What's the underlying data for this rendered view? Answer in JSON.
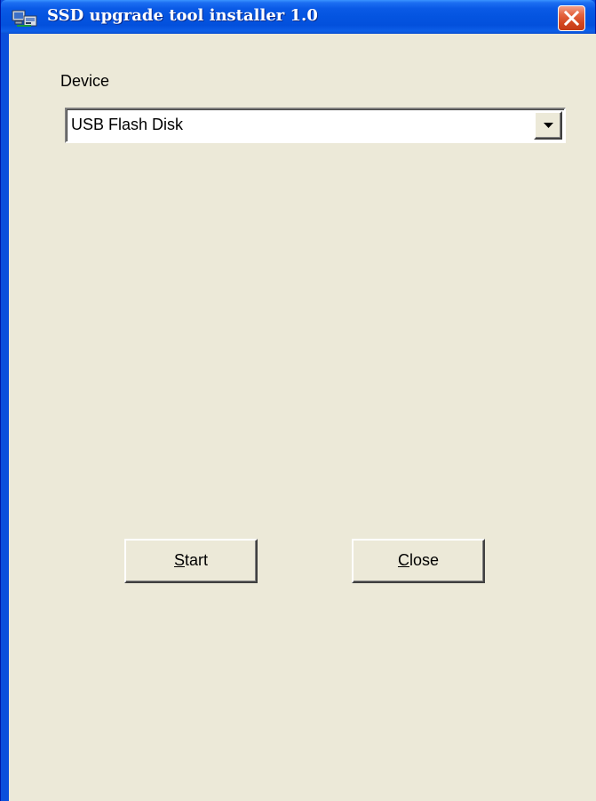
{
  "window": {
    "title": "SSD upgrade tool installer 1.0",
    "app_icon": "installer-computer-icon",
    "close_icon": "close-icon"
  },
  "form": {
    "device_label": "Device",
    "device_select": {
      "selected": "USB Flash Disk",
      "arrow_icon": "dropdown-arrow-icon"
    }
  },
  "buttons": {
    "start": {
      "first": "S",
      "rest": "tart"
    },
    "close": {
      "first": "C",
      "rest": "lose"
    }
  },
  "colors": {
    "titlebar": "#0454e0",
    "client_background": "#ece9d8",
    "close_button": "#d3461f"
  }
}
